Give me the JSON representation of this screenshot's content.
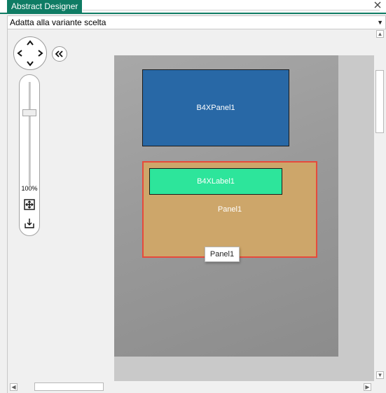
{
  "window": {
    "tab_title": "Abstract Designer"
  },
  "variant": {
    "selected": "Adatta alla variante scelta"
  },
  "controls": {
    "zoom_label": "100%",
    "zoom_level": 1.0
  },
  "designer": {
    "views": [
      {
        "name": "B4XPanel1",
        "color": "#2868a6"
      },
      {
        "name": "Panel1",
        "color": "#cda66a",
        "selected_border": "#e64a3c"
      },
      {
        "name": "B4XLabel1",
        "color": "#2de59b"
      }
    ],
    "tooltip": "Panel1"
  },
  "colors": {
    "accent": "#0f7c64",
    "canvas_bg": "#c9c9c9",
    "form_bg": "#9a9a9a"
  },
  "icons": {
    "pan": "pan-arrows-icon",
    "collapse": "double-chevron-left-icon",
    "fit": "fit-to-screen-icon",
    "export": "download-tray-icon",
    "dropdown": "chevron-down-icon"
  }
}
